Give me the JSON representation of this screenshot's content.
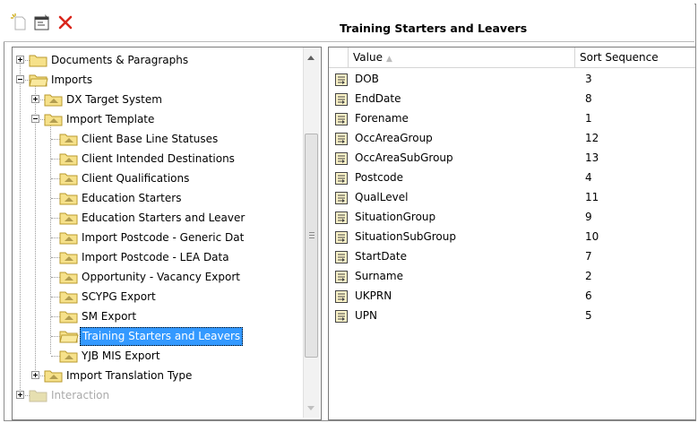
{
  "toolbar": {
    "buttons": [
      {
        "name": "new-item-icon"
      },
      {
        "name": "properties-icon"
      },
      {
        "name": "delete-icon",
        "color": "#d9261c"
      }
    ],
    "title": "Training Starters and Leavers"
  },
  "tree": {
    "items": [
      {
        "label": "Documents & Paragraphs",
        "level": 0,
        "expander": "plus",
        "icon": "folder-icon"
      },
      {
        "label": "Imports",
        "level": 0,
        "expander": "minus",
        "icon": "folder-open-icon"
      },
      {
        "label": "DX Target System",
        "level": 1,
        "expander": "plus",
        "icon": "folder-arrow-icon"
      },
      {
        "label": "Import Template",
        "level": 1,
        "expander": "minus",
        "icon": "folder-arrow-icon"
      },
      {
        "label": "Client Base Line Statuses",
        "level": 2,
        "icon": "folder-arrow-icon"
      },
      {
        "label": "Client Intended Destinations",
        "level": 2,
        "icon": "folder-arrow-icon"
      },
      {
        "label": "Client Qualifications",
        "level": 2,
        "icon": "folder-arrow-icon"
      },
      {
        "label": "Education Starters",
        "level": 2,
        "icon": "folder-arrow-icon"
      },
      {
        "label": "Education Starters and Leaver",
        "level": 2,
        "icon": "folder-arrow-icon"
      },
      {
        "label": "Import Postcode - Generic Dat",
        "level": 2,
        "icon": "folder-arrow-icon"
      },
      {
        "label": "Import Postcode - LEA Data",
        "level": 2,
        "icon": "folder-arrow-icon"
      },
      {
        "label": "Opportunity - Vacancy Export",
        "level": 2,
        "icon": "folder-arrow-icon"
      },
      {
        "label": "SCYPG Export",
        "level": 2,
        "icon": "folder-arrow-icon"
      },
      {
        "label": "SM Export",
        "level": 2,
        "icon": "folder-arrow-icon"
      },
      {
        "label": "Training Starters and Leavers",
        "level": 2,
        "icon": "folder-open-icon",
        "selected": true
      },
      {
        "label": "YJB MIS Export",
        "level": 2,
        "icon": "folder-arrow-icon"
      },
      {
        "label": "Import Translation Type",
        "level": 1,
        "expander": "plus",
        "icon": "folder-arrow-icon"
      },
      {
        "label": "Interaction",
        "level": 0,
        "expander": "plus",
        "icon": "folder-icon",
        "faded": true
      }
    ],
    "selection_color": "#3399ff"
  },
  "list": {
    "columns": [
      {
        "label": "Value"
      },
      {
        "label": "Sort Sequence"
      }
    ],
    "rows": [
      {
        "value": "DOB",
        "seq": "3"
      },
      {
        "value": "EndDate",
        "seq": "8"
      },
      {
        "value": "Forename",
        "seq": "1"
      },
      {
        "value": "OccAreaGroup",
        "seq": "12"
      },
      {
        "value": "OccAreaSubGroup",
        "seq": "13"
      },
      {
        "value": "Postcode",
        "seq": "4"
      },
      {
        "value": "QualLevel",
        "seq": "11"
      },
      {
        "value": "SituationGroup",
        "seq": "9"
      },
      {
        "value": "SituationSubGroup",
        "seq": "10"
      },
      {
        "value": "StartDate",
        "seq": "7"
      },
      {
        "value": "Surname",
        "seq": "2"
      },
      {
        "value": "UKPRN",
        "seq": "6"
      },
      {
        "value": "UPN",
        "seq": "5"
      }
    ],
    "row_icon": "field-icon"
  }
}
